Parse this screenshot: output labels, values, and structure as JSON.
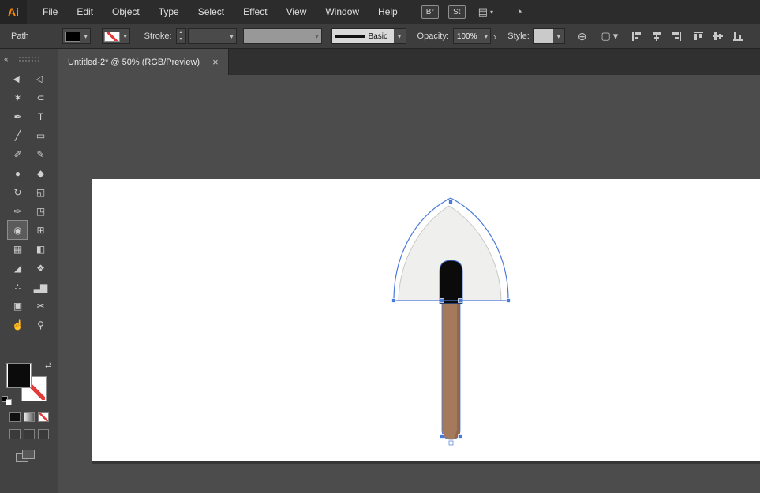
{
  "app": {
    "logo_text": "Ai",
    "menus": [
      "File",
      "Edit",
      "Object",
      "Type",
      "Select",
      "Effect",
      "View",
      "Window",
      "Help"
    ],
    "bar_buttons": [
      "Br",
      "St"
    ]
  },
  "icons": {
    "caret_down": "▾",
    "caret_up": "▴",
    "chevron_right": "›",
    "close": "×",
    "collapse": "«",
    "swap": "⇄",
    "globe": "⊕",
    "document_setup": "▢",
    "workspace": "▤",
    "live": "◔"
  },
  "control_bar": {
    "selection_label": "Path",
    "stroke_label": "Stroke:",
    "brush_preview_label": "Basic",
    "opacity_label": "Opacity:",
    "opacity_value": "100%",
    "style_label": "Style:"
  },
  "document_tab": {
    "title": "Untitled-2* @ 50% (RGB/Preview)"
  },
  "toolbar": {
    "tools": [
      {
        "name": "selection",
        "glyph": "▶"
      },
      {
        "name": "direct-selection",
        "glyph": "▷"
      },
      {
        "name": "magic-wand",
        "glyph": "✶"
      },
      {
        "name": "lasso",
        "glyph": "⊂"
      },
      {
        "name": "pen",
        "glyph": "✒"
      },
      {
        "name": "type",
        "glyph": "T"
      },
      {
        "name": "line-segment",
        "glyph": "╱"
      },
      {
        "name": "rectangle",
        "glyph": "▭"
      },
      {
        "name": "paintbrush",
        "glyph": "✐"
      },
      {
        "name": "pencil",
        "glyph": "✎"
      },
      {
        "name": "blob-brush",
        "glyph": "●"
      },
      {
        "name": "eraser",
        "glyph": "◆"
      },
      {
        "name": "rotate",
        "glyph": "↻"
      },
      {
        "name": "scale",
        "glyph": "◱"
      },
      {
        "name": "width",
        "glyph": "✑"
      },
      {
        "name": "free-transform",
        "glyph": "◳"
      },
      {
        "name": "shape-builder",
        "glyph": "◉",
        "selected": true
      },
      {
        "name": "perspective-grid",
        "glyph": "⊞"
      },
      {
        "name": "mesh",
        "glyph": "▦"
      },
      {
        "name": "gradient",
        "glyph": "◧"
      },
      {
        "name": "eyedropper",
        "glyph": "◢"
      },
      {
        "name": "blend",
        "glyph": "❖"
      },
      {
        "name": "symbol-sprayer",
        "glyph": "∴"
      },
      {
        "name": "column-graph",
        "glyph": "▂▆"
      },
      {
        "name": "artboard",
        "glyph": "▣"
      },
      {
        "name": "slice",
        "glyph": "✂"
      },
      {
        "name": "hand",
        "glyph": "☝"
      },
      {
        "name": "zoom",
        "glyph": "⚲"
      }
    ]
  },
  "colors": {
    "selection_blue": "#4a7ad9",
    "blade_fill": "#efefed",
    "handle_brown": "#a5795b",
    "handle_shade": "#8a6044",
    "grip_black": "#0b0b0b",
    "artboard_white": "#ffffff",
    "canvas_gray": "#4c4c4c",
    "accent_orange": "#ff8a00",
    "swatch_none_red": "#e23b3b"
  }
}
